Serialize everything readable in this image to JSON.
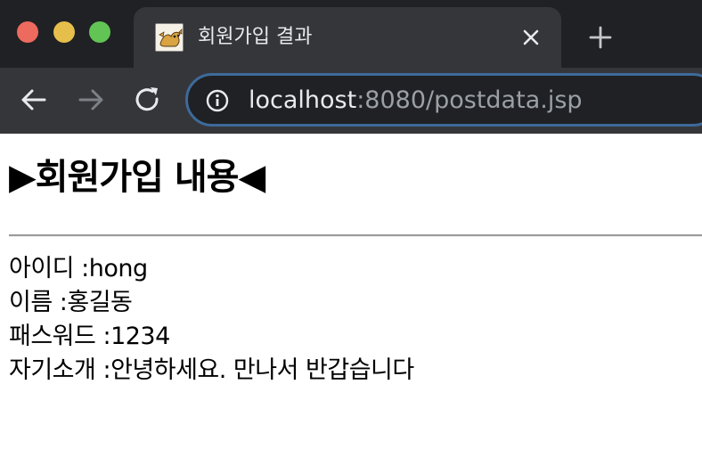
{
  "browser": {
    "tab_title": "회원가입 결과",
    "favicon": "tomcat-icon",
    "url_host": "localhost",
    "url_path": ":8080/postdata.jsp",
    "colors": {
      "frame": "#202124",
      "tab": "#35363a",
      "close_red": "#ed6a5e",
      "minimize_yellow": "#e6be4b",
      "zoom_green": "#61c454",
      "omnibox_focus": "#3d6a9a"
    }
  },
  "page": {
    "heading": "▶회원가입 내용◀",
    "fields": [
      {
        "label": "아이디",
        "value": "hong"
      },
      {
        "label": "이름",
        "value": "홍길동"
      },
      {
        "label": "패스워드",
        "value": "1234"
      },
      {
        "label": "자기소개",
        "value": "안녕하세요. 만나서 반갑습니다"
      }
    ]
  }
}
